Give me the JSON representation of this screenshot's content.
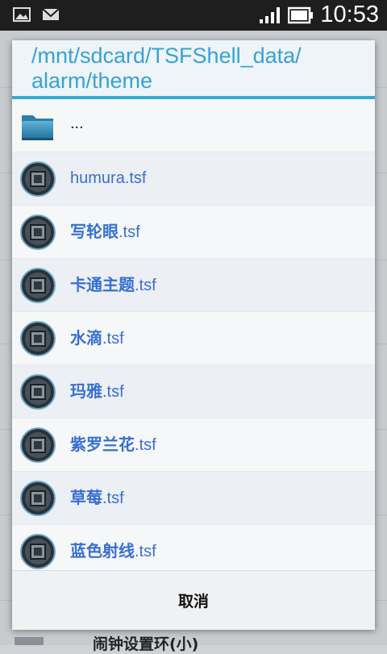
{
  "status_bar": {
    "time": "10:53",
    "icons": [
      "image-icon",
      "mail-icon",
      "signal-icon",
      "battery-icon"
    ]
  },
  "dialog": {
    "title": "/mnt/sdcard/TSFShell_data/\nalarm/theme",
    "parent_entry": "...",
    "files": [
      {
        "name": "humura",
        "ext": ".tsf"
      },
      {
        "name": "写轮眼",
        "ext": ".tsf"
      },
      {
        "name": "卡通主题",
        "ext": ".tsf"
      },
      {
        "name": "水滴",
        "ext": ".tsf"
      },
      {
        "name": "玛雅",
        "ext": ".tsf"
      },
      {
        "name": "紫罗兰花",
        "ext": ".tsf"
      },
      {
        "name": "草莓",
        "ext": ".tsf"
      },
      {
        "name": "蓝色射线",
        "ext": ".tsf"
      }
    ],
    "cancel_label": "取消"
  },
  "background": {
    "partial_text": "闹钟设置环(小)"
  },
  "colors": {
    "accent": "#36a3d4",
    "file_text": "#3770cf"
  }
}
